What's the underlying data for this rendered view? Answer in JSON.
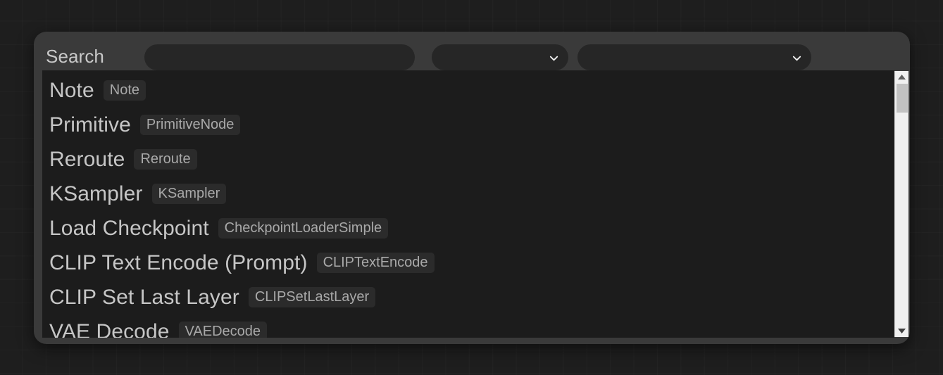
{
  "theme": {
    "canvas_bg": "#1e1e1e",
    "dialog_bg": "#3a3a3a",
    "list_bg": "#1c1c1c",
    "field_bg": "#262626",
    "text_primary": "#c6c6c6",
    "text_muted": "#a9a9a9",
    "badge_bg": "#2b2b2b",
    "scrollbar_track": "#f0f0f0",
    "scrollbar_thumb": "#c2c2c2"
  },
  "dialog": {
    "search": {
      "label": "Search",
      "value": "",
      "placeholder": ""
    },
    "filters": [
      {
        "name": "category-select",
        "value": "",
        "icon": "chevron-down-icon"
      },
      {
        "name": "node-select",
        "value": "",
        "icon": "chevron-down-icon"
      }
    ],
    "results": [
      {
        "title": "Note",
        "badge": "Note"
      },
      {
        "title": "Primitive",
        "badge": "PrimitiveNode"
      },
      {
        "title": "Reroute",
        "badge": "Reroute"
      },
      {
        "title": "KSampler",
        "badge": "KSampler"
      },
      {
        "title": "Load Checkpoint",
        "badge": "CheckpointLoaderSimple"
      },
      {
        "title": "CLIP Text Encode (Prompt)",
        "badge": "CLIPTextEncode"
      },
      {
        "title": "CLIP Set Last Layer",
        "badge": "CLIPSetLastLayer"
      },
      {
        "title": "VAE Decode",
        "badge": "VAEDecode"
      }
    ],
    "scrollbar": {
      "up_icon": "triangle-up-icon",
      "down_icon": "triangle-down-icon",
      "thumb_position_percent": 0
    }
  }
}
